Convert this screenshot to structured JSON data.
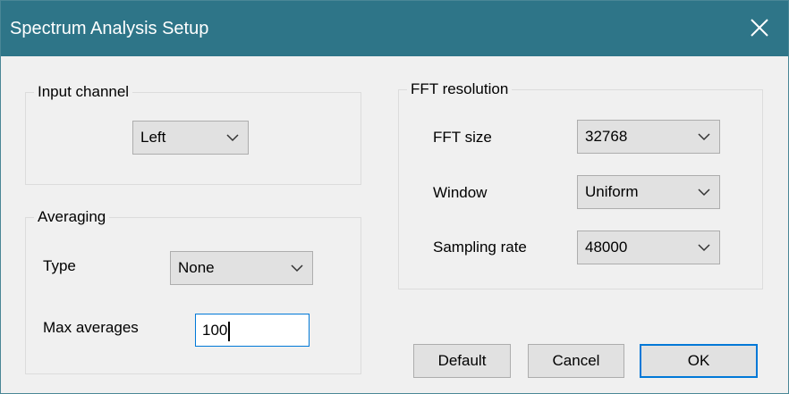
{
  "dialog": {
    "title": "Spectrum Analysis Setup",
    "close_glyph": "close-icon"
  },
  "input_channel": {
    "group_label": "Input channel",
    "channel": {
      "selected": "Left"
    }
  },
  "averaging": {
    "group_label": "Averaging",
    "type": {
      "label": "Type",
      "selected": "None"
    },
    "max_averages": {
      "label": "Max averages",
      "value": "100"
    }
  },
  "fft_resolution": {
    "group_label": "FFT resolution",
    "fft_size": {
      "label": "FFT size",
      "selected": "32768"
    },
    "window": {
      "label": "Window",
      "selected": "Uniform"
    },
    "sampling_rate": {
      "label": "Sampling rate",
      "selected": "48000"
    }
  },
  "buttons": {
    "default_label": "Default",
    "cancel_label": "Cancel",
    "ok_label": "OK"
  },
  "colors": {
    "titlebar": "#2e7588",
    "dialog_background": "#f0f0f0",
    "focus_accent": "#0078d7"
  }
}
